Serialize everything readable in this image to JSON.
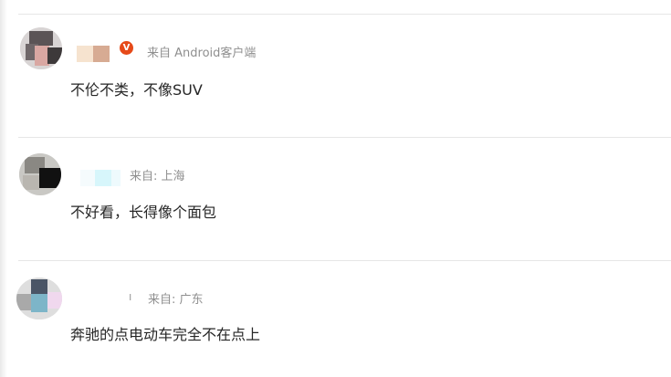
{
  "comments": [
    {
      "verified_badge": "V",
      "source": "来自 Android客户端",
      "text": "不伦不类，不像SUV"
    },
    {
      "source": "来自: 上海",
      "text": "不好看，长得像个面包"
    },
    {
      "source": "来自: 广东",
      "text": "奔驰的点电动车完全不在点上",
      "name_glyph": "ı"
    }
  ],
  "colors": {
    "verified_badge": "#e64a19",
    "source_text": "#8f8f8f",
    "divider": "#e6e6e6"
  }
}
